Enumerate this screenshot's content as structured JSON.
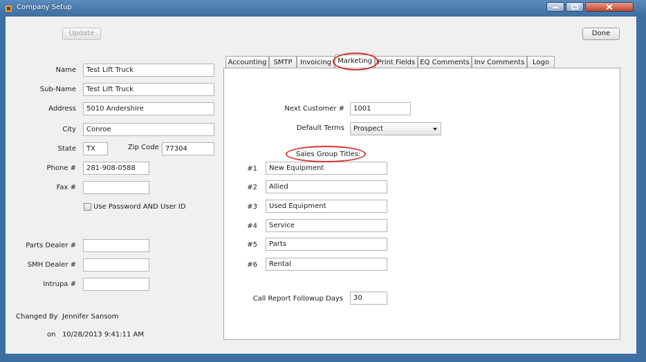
{
  "window": {
    "title": "Company Setup"
  },
  "toolbar": {
    "update_label": "Update",
    "done_label": "Done"
  },
  "company": {
    "name_label": "Name",
    "name": "Test Lift Truck",
    "subname_label": "Sub-Name",
    "subname": "Test Lift Truck",
    "address_label": "Address",
    "address": "5010 Andershire",
    "city_label": "City",
    "city": "Conroe",
    "state_label": "State",
    "state": "TX",
    "zip_label": "Zip Code",
    "zip": "77304",
    "phone_label": "Phone #",
    "phone": "281-908-0588",
    "fax_label": "Fax #",
    "fax": "",
    "use_password_label": "Use Password AND User ID",
    "parts_dealer_label": "Parts Dealer #",
    "parts_dealer": "",
    "smh_dealer_label": "SMH Dealer #",
    "smh_dealer": "",
    "intrupa_label": "Intrupa #",
    "intrupa": "",
    "changed_by_label": "Changed By",
    "changed_by": "Jennifer Sansom",
    "on_label": "on",
    "changed_on": "10/28/2013 9:41:11 AM"
  },
  "tabs": [
    {
      "label": "Accounting"
    },
    {
      "label": "SMTP"
    },
    {
      "label": "Invoicing"
    },
    {
      "label": "Marketing"
    },
    {
      "label": "Print Fields"
    },
    {
      "label": "EQ Comments"
    },
    {
      "label": "Inv Comments"
    },
    {
      "label": "Logo"
    }
  ],
  "marketing": {
    "next_customer_label": "Next Customer #",
    "next_customer": "1001",
    "default_terms_label": "Default Terms",
    "default_terms": "Prospect",
    "sales_group_titles_label": "Sales Group Titles:",
    "groups": [
      {
        "num": "#1",
        "value": "New Equipment"
      },
      {
        "num": "#2",
        "value": "Allied"
      },
      {
        "num": "#3",
        "value": "Used Equipment"
      },
      {
        "num": "#4",
        "value": "Service"
      },
      {
        "num": "#5",
        "value": "Parts"
      },
      {
        "num": "#6",
        "value": "Rental"
      }
    ],
    "followup_label": "Call Report Followup Days",
    "followup_days": "30"
  },
  "colors": {
    "highlight": "#d6322b",
    "titlebar": "#3e6d9f"
  }
}
